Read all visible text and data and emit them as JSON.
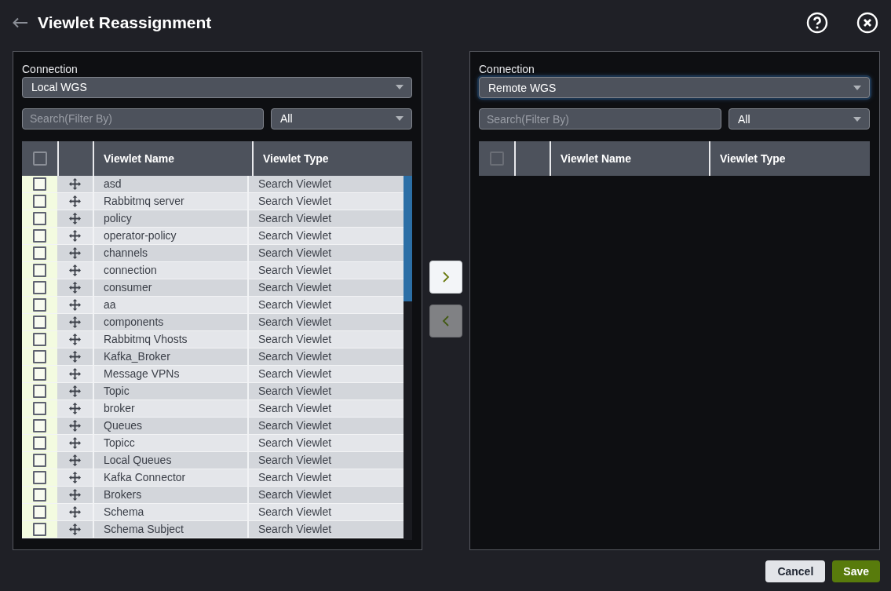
{
  "header": {
    "title": "Viewlet Reassignment"
  },
  "panels": [
    {
      "connection_label": "Connection",
      "connection": "Local WGS",
      "focused": false,
      "search_placeholder": "Search(Filter By)",
      "filter": "All",
      "select_all": {
        "checked": false,
        "disabled": false
      },
      "columns": [
        "Viewlet Name",
        "Viewlet Type"
      ],
      "rows": [
        {
          "name": "asd",
          "type": "Search Viewlet",
          "checked": false
        },
        {
          "name": "Rabbitmq server",
          "type": "Search Viewlet",
          "checked": false
        },
        {
          "name": "policy",
          "type": "Search Viewlet",
          "checked": false
        },
        {
          "name": "operator-policy",
          "type": "Search Viewlet",
          "checked": false
        },
        {
          "name": "channels",
          "type": "Search Viewlet",
          "checked": false
        },
        {
          "name": "connection",
          "type": "Search Viewlet",
          "checked": false
        },
        {
          "name": "consumer",
          "type": "Search Viewlet",
          "checked": false
        },
        {
          "name": "aa",
          "type": "Search Viewlet",
          "checked": false
        },
        {
          "name": "components",
          "type": "Search Viewlet",
          "checked": false
        },
        {
          "name": "Rabbitmq Vhosts",
          "type": "Search Viewlet",
          "checked": false
        },
        {
          "name": "Kafka_Broker",
          "type": "Search Viewlet",
          "checked": false
        },
        {
          "name": "Message VPNs",
          "type": "Search Viewlet",
          "checked": false
        },
        {
          "name": "Topic",
          "type": "Search Viewlet",
          "checked": false
        },
        {
          "name": "broker",
          "type": "Search Viewlet",
          "checked": false
        },
        {
          "name": "Queues",
          "type": "Search Viewlet",
          "checked": false
        },
        {
          "name": "Topicc",
          "type": "Search Viewlet",
          "checked": false
        },
        {
          "name": "Local Queues",
          "type": "Search Viewlet",
          "checked": false
        },
        {
          "name": "Kafka Connector",
          "type": "Search Viewlet",
          "checked": false
        },
        {
          "name": "Brokers",
          "type": "Search Viewlet",
          "checked": false
        },
        {
          "name": "Schema",
          "type": "Search Viewlet",
          "checked": false
        },
        {
          "name": "Schema Subject",
          "type": "Search Viewlet",
          "checked": false
        }
      ]
    },
    {
      "connection_label": "Connection",
      "connection": "Remote WGS",
      "focused": true,
      "search_placeholder": "Search(Filter By)",
      "filter": "All",
      "select_all": {
        "checked": false,
        "disabled": true
      },
      "columns": [
        "Viewlet Name",
        "Viewlet Type"
      ]
    }
  ],
  "transfer_buttons": [
    {
      "kind": "right",
      "disabled": false
    },
    {
      "kind": "left",
      "disabled": true
    }
  ],
  "footer": {
    "buttons": [
      {
        "label": "Cancel",
        "kind": "secondary"
      },
      {
        "label": "Save",
        "kind": "primary"
      }
    ]
  }
}
